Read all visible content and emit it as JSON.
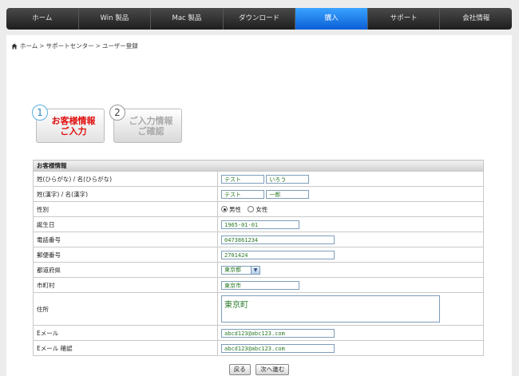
{
  "nav": [
    {
      "label": "ホーム"
    },
    {
      "label": "Win 製品"
    },
    {
      "label": "Mac 製品"
    },
    {
      "label": "ダウンロード"
    },
    {
      "label": "購入"
    },
    {
      "label": "サポート"
    },
    {
      "label": "会社情報"
    }
  ],
  "breadcrumb": {
    "home": "ホーム",
    "support": "サポートセンター",
    "current": "ユーザー登録",
    "sep": ">"
  },
  "steps": [
    {
      "num": "1",
      "line1": "お客様情報",
      "line2": "ご入力"
    },
    {
      "num": "2",
      "line1": "ご入力情報",
      "line2": "ご確認"
    }
  ],
  "form": {
    "title": "お客様情報",
    "kana_label": "姓(ひらがな) / 名(ひらがな)",
    "kana_sei": "テスト",
    "kana_mei": "いろう",
    "kanji_label": "姓(漢字) / 名(漢字)",
    "kanji_sei": "テスト",
    "kanji_mei": "一郎",
    "gender_label": "性別",
    "male": "男性",
    "female": "女性",
    "birth_label": "誕生日",
    "birth": "1965-01-01",
    "phone_label": "電話番号",
    "phone": "0473861234",
    "zip_label": "郵便番号",
    "zip": "2701424",
    "pref_label": "都道府県",
    "pref": "東京都",
    "city_label": "市町村",
    "city": "東京市",
    "address_label": "住所",
    "address": "東京町",
    "email_label": "Eメール",
    "email": "abcd123@abc123.com",
    "email2_label": "Eメール 確認",
    "email2": "abcd123@abc123.com"
  },
  "buttons": {
    "back": "戻る",
    "next": "次へ進む"
  }
}
